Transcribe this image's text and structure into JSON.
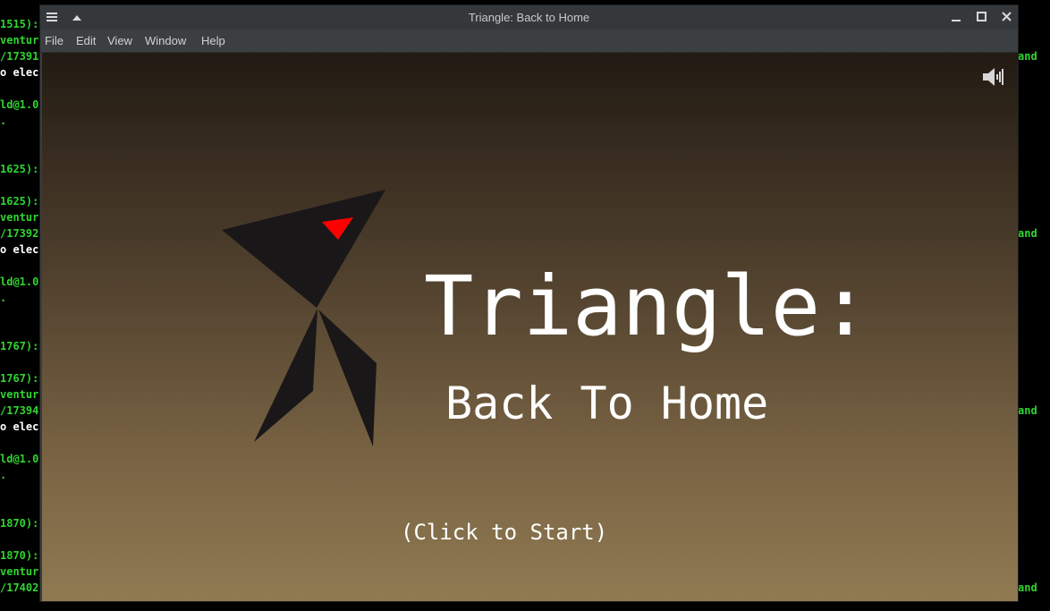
{
  "window": {
    "title": "Triangle: Back to Home",
    "menu": [
      "File",
      "Edit",
      "View",
      "Window",
      "Help"
    ]
  },
  "terminal": {
    "left_lines": [
      {
        "text": "1515):",
        "white": false
      },
      {
        "text": "ventur",
        "white": false
      },
      {
        "text": "/17391",
        "white": false
      },
      {
        "text": "o elec",
        "white": true
      },
      {
        "text": "",
        "white": false
      },
      {
        "text": "ld@1.0",
        "white": false
      },
      {
        "text": ".",
        "white": false
      },
      {
        "text": "",
        "white": false
      },
      {
        "text": "",
        "white": false
      },
      {
        "text": "1625):",
        "white": false
      },
      {
        "text": "",
        "white": false
      },
      {
        "text": "1625):",
        "white": false
      },
      {
        "text": "ventur",
        "white": false
      },
      {
        "text": "/17392",
        "white": false
      },
      {
        "text": "o elec",
        "white": true
      },
      {
        "text": "",
        "white": false
      },
      {
        "text": "ld@1.0",
        "white": false
      },
      {
        "text": ".",
        "white": false
      },
      {
        "text": "",
        "white": false
      },
      {
        "text": "",
        "white": false
      },
      {
        "text": "1767):",
        "white": false
      },
      {
        "text": "",
        "white": false
      },
      {
        "text": "1767):",
        "white": false
      },
      {
        "text": "ventur",
        "white": false
      },
      {
        "text": "/17394",
        "white": false
      },
      {
        "text": "o elec",
        "white": true
      },
      {
        "text": "",
        "white": false
      },
      {
        "text": "ld@1.0",
        "white": false
      },
      {
        "text": ".",
        "white": false
      },
      {
        "text": "",
        "white": false
      },
      {
        "text": "",
        "white": false
      },
      {
        "text": "1870):",
        "white": false
      },
      {
        "text": "",
        "white": false
      },
      {
        "text": "1870):",
        "white": false
      },
      {
        "text": "ventur",
        "white": false
      },
      {
        "text": "/17402",
        "white": false
      }
    ],
    "right_lines": [
      "and",
      "and",
      "and",
      "and"
    ]
  },
  "game": {
    "title": "Triangle:",
    "subtitle": "Back To Home",
    "cta": "(Click to Start)",
    "sound_icon": "speaker-muted-icon",
    "colors": {
      "sky_top": "#221b13",
      "sky_bottom": "#8f7a52",
      "bird": "#1a1718",
      "eye": "#ff0000"
    }
  }
}
